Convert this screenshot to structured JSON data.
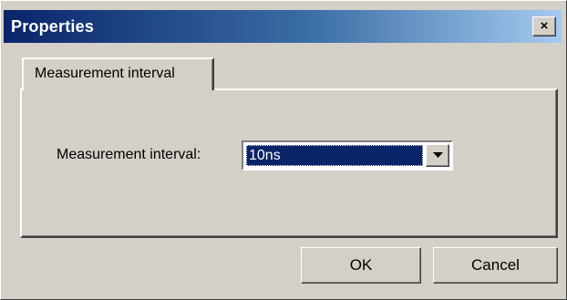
{
  "window": {
    "title": "Properties",
    "close_glyph": "×"
  },
  "tabs": [
    {
      "label": "Measurement interval",
      "selected": true
    }
  ],
  "form": {
    "interval_label": "Measurement interval:",
    "interval_value": "10ns"
  },
  "buttons": {
    "ok_label": "OK",
    "cancel_label": "Cancel"
  },
  "colors": {
    "dialog_face": "#d4d0c8",
    "titlebar_start": "#0a246a",
    "titlebar_end": "#a6caf0",
    "selection": "#0a246a"
  },
  "icons": {
    "dropdown": "chevron-down-icon",
    "close": "close-icon"
  }
}
